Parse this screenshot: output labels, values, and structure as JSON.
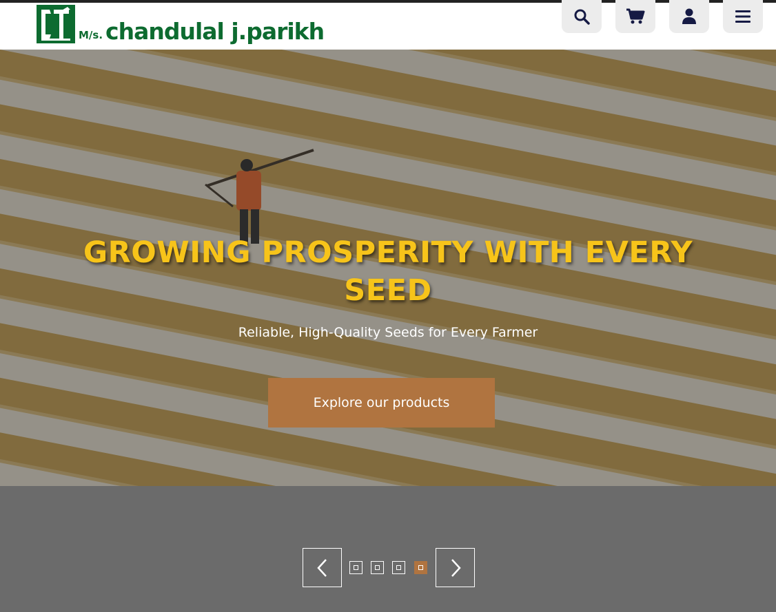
{
  "brand": {
    "prefix": "M/s.",
    "name": "chandulal j.parikh",
    "color": "#0d6b30"
  },
  "header": {
    "buttons": [
      {
        "icon": "search-icon"
      },
      {
        "icon": "cart-icon"
      },
      {
        "icon": "user-icon"
      },
      {
        "icon": "menu-icon"
      }
    ]
  },
  "hero": {
    "title": "GROWING PROSPERITY WITH EVERY SEED",
    "subtitle": "Reliable, High-Quality Seeds for Every Farmer",
    "cta_label": "Explore our products",
    "title_color": "#f7c41a",
    "cta_color": "#b07440"
  },
  "slider": {
    "prev_icon": "chevron-left-icon",
    "next_icon": "chevron-right-icon",
    "dot_count": 4,
    "active_index": 3
  }
}
